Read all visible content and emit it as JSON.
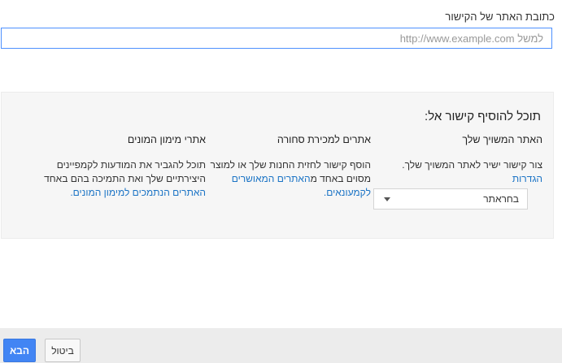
{
  "url_section": {
    "label": "כתובת האתר של הקישור",
    "placeholder": "למשל http://www.example.com",
    "value": ""
  },
  "destination_panel": {
    "title": "תוכל להוסיף קישור אל:",
    "columns": [
      {
        "heading": "האתר המשויך שלך",
        "text": "צור קישור ישיר לאתר המשויך שלך.",
        "link": "הגדרות",
        "select": {
          "selected": "בחראתר"
        }
      },
      {
        "heading": "אתרים למכירת סחורה",
        "text": "הוסף קישור לחזית החנות שלך או למוצר מסוים באחד מ",
        "link": "האתרים המאושרים לקמעונאים."
      },
      {
        "heading": "אתרי מימון המונים",
        "text": "תוכל להגביר את המודעות לקמפיינים היצירתיים שלך ואת התמיכה בהם באחד ",
        "link": "האתרים הנתמכים למימון המונים."
      }
    ]
  },
  "footer": {
    "next_label": "הבא",
    "cancel_label": "ביטול"
  },
  "colors": {
    "accent": "#4285f4",
    "link": "#1a73c5",
    "panel_bg": "#f6f6f6",
    "footer_bg": "#ececec"
  }
}
